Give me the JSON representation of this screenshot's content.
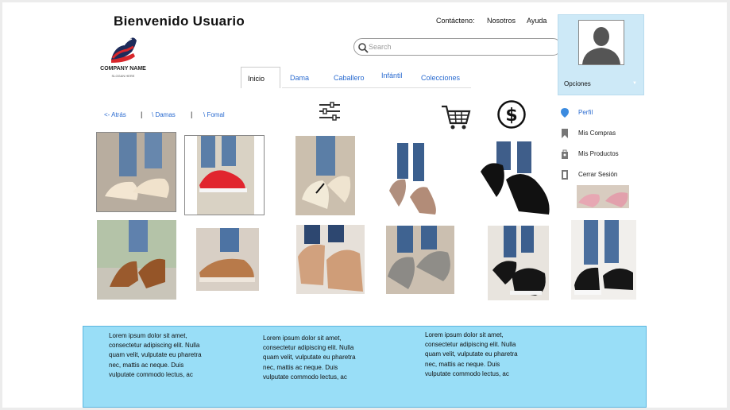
{
  "header": {
    "welcome": "Bienvenido Usuario",
    "company_name": "COMPANY NAME",
    "slogan": "SLOGAN HERE",
    "nav": [
      "Contácteno:",
      "Nosotros",
      "Ayuda"
    ]
  },
  "search": {
    "placeholder": "Search",
    "value": ""
  },
  "tabs": [
    "Inicio",
    "Dama",
    "Caballero",
    "Infántil",
    "Colecciones"
  ],
  "profile": {
    "options_label": "Opciones",
    "menu": [
      "Perfil",
      "Mis Compras",
      "Mis Productos",
      "Cerrar Sesión"
    ]
  },
  "breadcrumb": {
    "back": "<- Atrás",
    "sep": "|",
    "ladies": "\\ Damas",
    "formal": "\\ Fomal"
  },
  "icons": [
    "filter-icon",
    "cart-icon",
    "dollar-icon"
  ],
  "colors": {
    "accent": "#2a6bd0",
    "panel": "#cde9f7",
    "footer": "#99def7"
  },
  "footer": {
    "columns": [
      "Lorem ipsum dolor sit amet, consectetur adipiscing elit. Nulla quam velit, vulputate eu pharetra nec, mattis ac neque. Duis vulputate commodo lectus, ac",
      "Lorem ipsum dolor sit amet, consectetur adipiscing elit. Nulla quam velit, vulputate eu pharetra nec, mattis ac neque. Duis vulputate commodo lectus, ac",
      "Lorem ipsum dolor sit amet, consectetur adipiscing elit. Nulla quam velit, vulputate eu pharetra nec, mattis ac neque. Duis vulputate commodo lectus, ac"
    ]
  }
}
